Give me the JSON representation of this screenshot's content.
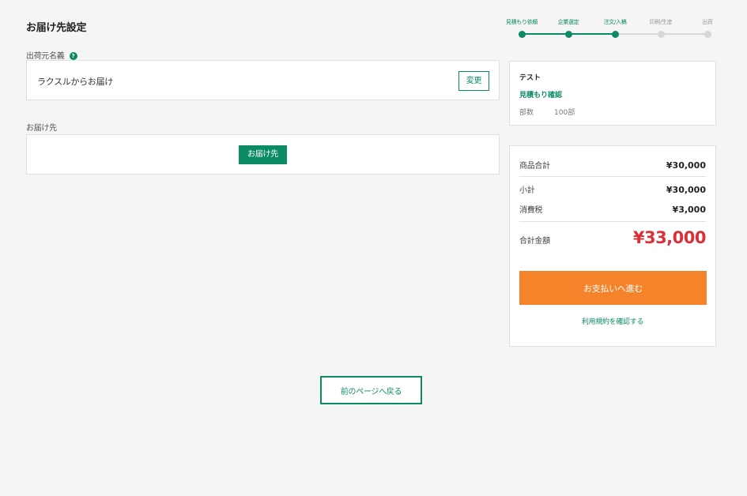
{
  "page": {
    "title": "お届け先設定"
  },
  "stepper": {
    "steps": [
      {
        "label": "見積もり依頼",
        "state": "done"
      },
      {
        "label": "企業選定",
        "state": "done"
      },
      {
        "label": "注文/入稿",
        "state": "done"
      },
      {
        "label": "印刷/生産",
        "state": "todo"
      },
      {
        "label": "出荷",
        "state": "todo"
      }
    ]
  },
  "sender": {
    "label": "出荷元名義",
    "help_icon": "?",
    "name": "ラクスルからお届け",
    "change_label": "変更"
  },
  "destination": {
    "label": "お届け先",
    "button_label": "お届け先"
  },
  "product": {
    "name": "テスト",
    "quote_link": "見積もり確認",
    "qty_label": "部数",
    "qty_value": "100部"
  },
  "summary": {
    "product_total_label": "商品合計",
    "product_total_value": "¥30,000",
    "subtotal_label": "小計",
    "subtotal_value": "¥30,000",
    "tax_label": "消費税",
    "tax_value": "¥3,000",
    "total_label": "合計金額",
    "total_value": "¥33,000",
    "pay_button_label": "お支払いへ進む",
    "terms_link": "利用規約を確認する"
  },
  "footer": {
    "back_label": "前のページへ戻る"
  },
  "colors": {
    "accent": "#0b8a66",
    "cta": "#f5832a",
    "total": "#d9303a"
  }
}
